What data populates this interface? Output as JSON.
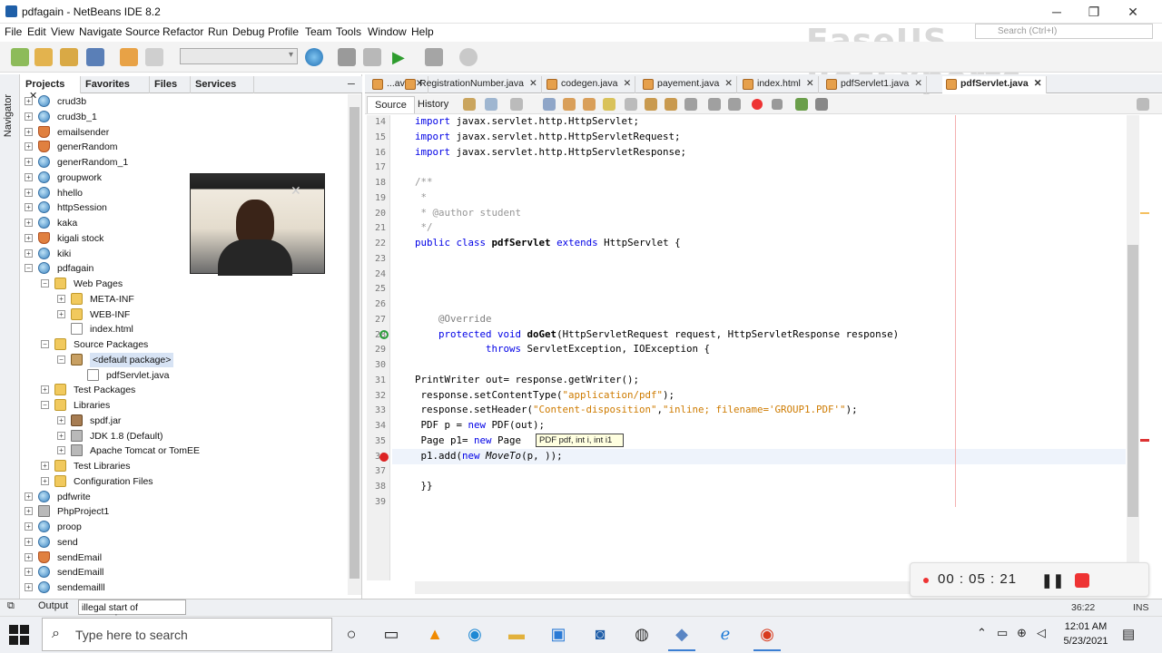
{
  "window": {
    "title": "pdfagain - NetBeans IDE 8.2",
    "minimize": "─",
    "maximize": "❐",
    "close": "✕"
  },
  "menu": [
    "File",
    "Edit",
    "View",
    "Navigate",
    "Source",
    "Refactor",
    "Run",
    "Debug",
    "Profile",
    "Team",
    "Tools",
    "Window",
    "Help"
  ],
  "search": {
    "placeholder": "Search (Ctrl+I)"
  },
  "watermark": "EaseUS RecExperts",
  "navigator_label": "Navigator",
  "project_tabs": [
    {
      "label": "Projects",
      "close": "✕"
    },
    {
      "label": "Favorites"
    },
    {
      "label": "Files"
    },
    {
      "label": "Services"
    }
  ],
  "panel_minimize": "─",
  "tree": [
    {
      "label": "crud3b",
      "icon": "globe-icon",
      "depth": 0,
      "exp": "+"
    },
    {
      "label": "crud3b_1",
      "icon": "globe-icon",
      "depth": 0,
      "exp": "+"
    },
    {
      "label": "emailsender",
      "icon": "coffee-cup-icon",
      "depth": 0,
      "exp": "+"
    },
    {
      "label": "generRandom",
      "icon": "coffee-cup-icon",
      "depth": 0,
      "exp": "+"
    },
    {
      "label": "generRandom_1",
      "icon": "globe-icon",
      "depth": 0,
      "exp": "+"
    },
    {
      "label": "groupwork",
      "icon": "globe-icon",
      "depth": 0,
      "exp": "+"
    },
    {
      "label": "hhello",
      "icon": "globe-icon",
      "depth": 0,
      "exp": "+"
    },
    {
      "label": "httpSession",
      "icon": "globe-icon",
      "depth": 0,
      "exp": "+"
    },
    {
      "label": "kaka",
      "icon": "globe-icon",
      "depth": 0,
      "exp": "+"
    },
    {
      "label": "kigali stock",
      "icon": "coffee-cup-icon",
      "depth": 0,
      "exp": "+"
    },
    {
      "label": "kiki",
      "icon": "globe-icon",
      "depth": 0,
      "exp": "+"
    },
    {
      "label": "pdfagain",
      "icon": "globe-icon",
      "depth": 0,
      "exp": "−"
    },
    {
      "label": "Web Pages",
      "icon": "folder-icon",
      "depth": 1,
      "exp": "−"
    },
    {
      "label": "META-INF",
      "icon": "folder-icon",
      "depth": 2,
      "exp": "+"
    },
    {
      "label": "WEB-INF",
      "icon": "folder-icon",
      "depth": 2,
      "exp": "+"
    },
    {
      "label": "index.html",
      "icon": "html-file-icon",
      "depth": 2,
      "exp": ""
    },
    {
      "label": "Source Packages",
      "icon": "package-folder-icon",
      "depth": 1,
      "exp": "−"
    },
    {
      "label": "<default package>",
      "icon": "package-icon",
      "depth": 2,
      "exp": "−",
      "selected": true
    },
    {
      "label": "pdfServlet.java",
      "icon": "java-file-icon",
      "depth": 3,
      "exp": ""
    },
    {
      "label": "Test Packages",
      "icon": "package-folder-icon",
      "depth": 1,
      "exp": "+"
    },
    {
      "label": "Libraries",
      "icon": "folder-icon",
      "depth": 1,
      "exp": "−"
    },
    {
      "label": "spdf.jar",
      "icon": "jar-icon",
      "depth": 2,
      "exp": "+"
    },
    {
      "label": "JDK 1.8 (Default)",
      "icon": "library-icon",
      "depth": 2,
      "exp": "+"
    },
    {
      "label": "Apache Tomcat or TomEE",
      "icon": "library-icon",
      "depth": 2,
      "exp": "+"
    },
    {
      "label": "Test Libraries",
      "icon": "folder-icon",
      "depth": 1,
      "exp": "+"
    },
    {
      "label": "Configuration Files",
      "icon": "folder-icon",
      "depth": 1,
      "exp": "+"
    },
    {
      "label": "pdfwrite",
      "icon": "globe-icon",
      "depth": 0,
      "exp": "+"
    },
    {
      "label": "PhpProject1",
      "icon": "php-icon",
      "depth": 0,
      "exp": "+"
    },
    {
      "label": "proop",
      "icon": "globe-icon",
      "depth": 0,
      "exp": "+"
    },
    {
      "label": "send",
      "icon": "globe-icon",
      "depth": 0,
      "exp": "+"
    },
    {
      "label": "sendEmail",
      "icon": "coffee-cup-icon",
      "depth": 0,
      "exp": "+"
    },
    {
      "label": "sendEmaill",
      "icon": "globe-icon",
      "depth": 0,
      "exp": "+"
    },
    {
      "label": "sendemailll",
      "icon": "globe-icon",
      "depth": 0,
      "exp": "+"
    }
  ],
  "editor_tabs": [
    {
      "label": "...ava",
      "close": "✕"
    },
    {
      "label": "RegistrationNumber.java",
      "close": "✕"
    },
    {
      "label": "codegen.java",
      "close": "✕"
    },
    {
      "label": "payement.java",
      "close": "✕"
    },
    {
      "label": "index.html",
      "close": "✕"
    },
    {
      "label": "pdfServlet1.java",
      "close": "✕"
    },
    {
      "label": "pdfServlet.java",
      "close": "✕",
      "active": true
    }
  ],
  "editor_views": {
    "source": "Source",
    "history": "History"
  },
  "code_lines": [
    {
      "n": "14",
      "html": "<span class=\"kw\">import</span> javax.servlet.http.HttpServlet;"
    },
    {
      "n": "15",
      "html": "<span class=\"kw\">import</span> javax.servlet.http.HttpServletRequest;"
    },
    {
      "n": "16",
      "html": "<span class=\"kw\">import</span> javax.servlet.http.HttpServletResponse;"
    },
    {
      "n": "17",
      "html": ""
    },
    {
      "n": "18",
      "html": "<span class=\"cmt\">/**</span>"
    },
    {
      "n": "19",
      "html": "<span class=\"cmt\"> *</span>"
    },
    {
      "n": "20",
      "html": "<span class=\"cmt\"> * @author student</span>"
    },
    {
      "n": "21",
      "html": "<span class=\"cmt\"> */</span>"
    },
    {
      "n": "22",
      "html": "<span class=\"kw\">public class</span> <b>pdfServlet</b> <span class=\"kw\">extends</span> HttpServlet {"
    },
    {
      "n": "23",
      "html": ""
    },
    {
      "n": "24",
      "html": ""
    },
    {
      "n": "25",
      "html": ""
    },
    {
      "n": "26",
      "html": ""
    },
    {
      "n": "27",
      "html": "    <span class=\"annot\">@Override</span>"
    },
    {
      "n": "28",
      "html": "    <span class=\"kw\">protected void</span> <b>doGet</b>(HttpServletRequest request, HttpServletResponse response)"
    },
    {
      "n": "29",
      "html": "            <span class=\"kw\">throws</span> ServletException, IOException {"
    },
    {
      "n": "30",
      "html": ""
    },
    {
      "n": "31",
      "html": "PrintWriter out= response.getWriter();"
    },
    {
      "n": "32",
      "html": " response.setContentType(<span class=\"str\">\"application/pdf\"</span>);"
    },
    {
      "n": "33",
      "html": " response.setHeader(<span class=\"str\">\"Content-disposition\"</span>,<span class=\"str\">\"inline; filename='GROUP1.PDF'\"</span>);"
    },
    {
      "n": "34",
      "html": " PDF p = <span class=\"kw\">new</span> PDF(out);"
    },
    {
      "n": "35",
      "html": " Page p1= <span class=\"kw\">new</span> Page"
    },
    {
      "n": "36",
      "html": " p1.add(<span class=\"kw\">new</span> <i>MoveTo</i>(p, ));"
    },
    {
      "n": "37",
      "html": ""
    },
    {
      "n": "38",
      "html": " }}"
    },
    {
      "n": "39",
      "html": ""
    }
  ],
  "tooltip": {
    "text": "PDF pdf, int i, int i1"
  },
  "recorder": {
    "time": "00 : 05 : 21",
    "pause": "❚❚"
  },
  "status": {
    "output_tab": "Output",
    "message": "illegal start of expression",
    "position": "36:22",
    "mode": "INS"
  },
  "taskbar": {
    "search_placeholder": "Type here to search",
    "time": "12:01 AM",
    "date": "5/23/2021"
  },
  "colors": {
    "keyword": "#0000e6",
    "string": "#ce7b00",
    "comment": "#969696",
    "error": "#d22222",
    "accent": "#3b7fd3"
  }
}
